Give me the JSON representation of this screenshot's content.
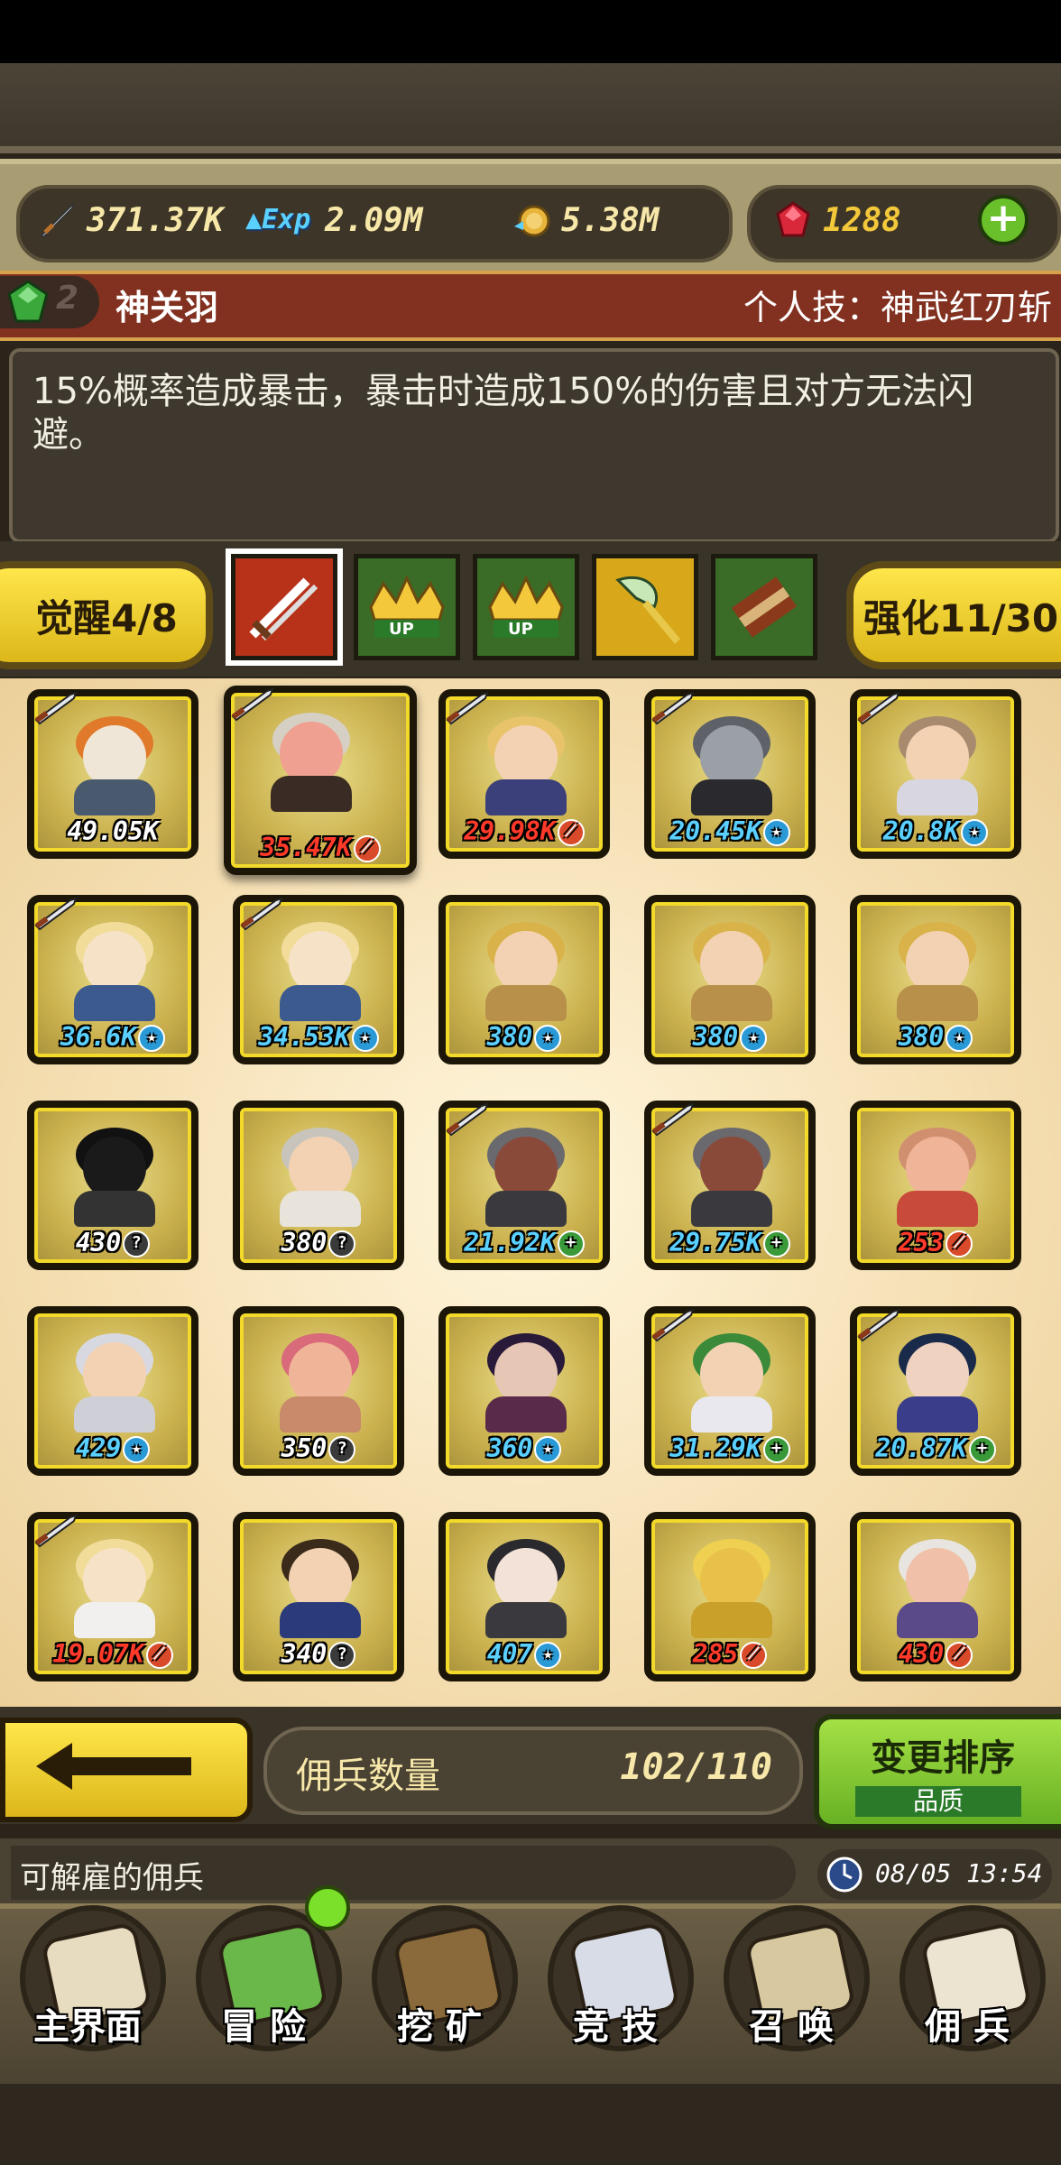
{
  "resources": {
    "attack": "371.37K",
    "exp": "2.09M",
    "gold": "5.38M",
    "gems": "1288"
  },
  "hero": {
    "level_badge": "2",
    "name": "神关羽",
    "skill_title": "个人技：神武红刃斩",
    "skill_desc": "15%概率造成暴击，暴击时造成150%的伤害且对方无法闪避。"
  },
  "tabs": {
    "awaken": "觉醒4/8",
    "enhance": "强化11/30"
  },
  "mercenaries": [
    {
      "value": "49.05K",
      "badge": "",
      "color": "#f0e6d8",
      "body": "#4a5a6e",
      "hair": "#e07a2a"
    },
    {
      "value": "35.47K",
      "badge": "fire",
      "color": "#f0a090",
      "body": "#3a2c24",
      "hair": "#d6d0c4"
    },
    {
      "value": "29.98K",
      "badge": "fire",
      "color": "#f3d2b4",
      "body": "#3b3f7a",
      "hair": "#e8c36a"
    },
    {
      "value": "20.45K",
      "badge": "star",
      "color": "#9aa0a6",
      "body": "#2a2a2e",
      "hair": "#5e6268"
    },
    {
      "value": "20.8K",
      "badge": "star",
      "color": "#f3d2b4",
      "body": "#d8d6e0",
      "hair": "#a88a6e"
    },
    {
      "value": "36.6K",
      "badge": "star",
      "color": "#f6e2c6",
      "body": "#3c5a8e",
      "hair": "#f1dc9a"
    },
    {
      "value": "34.53K",
      "badge": "star",
      "color": "#f6e2c6",
      "body": "#3c5a8e",
      "hair": "#f1dc9a"
    },
    {
      "value": "380",
      "badge": "star",
      "color": "#f3d2b4",
      "body": "#b8904a",
      "hair": "#d9b34a"
    },
    {
      "value": "380",
      "badge": "star",
      "color": "#f3d2b4",
      "body": "#b8904a",
      "hair": "#d9b34a"
    },
    {
      "value": "380",
      "badge": "star",
      "color": "#f3d2b4",
      "body": "#b8904a",
      "hair": "#d9b34a"
    },
    {
      "value": "430",
      "badge": "q",
      "color": "#1a1a1a",
      "body": "#333333",
      "hair": "#111111"
    },
    {
      "value": "380",
      "badge": "q",
      "color": "#f3d2b4",
      "body": "#e8e4dc",
      "hair": "#c8c4bc"
    },
    {
      "value": "21.92K",
      "badge": "plus",
      "color": "#8a4a3a",
      "body": "#3a3a3e",
      "hair": "#6a6a6e"
    },
    {
      "value": "29.75K",
      "badge": "plus",
      "color": "#8a4a3a",
      "body": "#3a3a3e",
      "hair": "#6a6a6e"
    },
    {
      "value": "253",
      "badge": "fire",
      "color": "#f0b498",
      "body": "#c84a3a",
      "hair": "#d09070"
    },
    {
      "value": "429",
      "badge": "star",
      "color": "#f3d2b4",
      "body": "#cfcfd8",
      "hair": "#d8d8e0"
    },
    {
      "value": "350",
      "badge": "q",
      "color": "#f0b498",
      "body": "#c88a6a",
      "hair": "#d86a7a"
    },
    {
      "value": "360",
      "badge": "star",
      "color": "#e6c6b4",
      "body": "#5a2a4a",
      "hair": "#2a1a3a"
    },
    {
      "value": "31.29K",
      "badge": "plus",
      "color": "#f3d2b4",
      "body": "#e8e8ee",
      "hair": "#3a8a3a"
    },
    {
      "value": "20.87K",
      "badge": "plus",
      "color": "#f0d2c0",
      "body": "#3a3e8a",
      "hair": "#1a2a4a"
    },
    {
      "value": "19.07K",
      "badge": "fire",
      "color": "#f6e2c6",
      "body": "#f2f0ee",
      "hair": "#f1dc9a"
    },
    {
      "value": "340",
      "badge": "q",
      "color": "#f3d2b4",
      "body": "#2a3a7a",
      "hair": "#3a2a1a"
    },
    {
      "value": "407",
      "badge": "star",
      "color": "#f3e2d8",
      "body": "#3a3a3e",
      "hair": "#2a2a2e"
    },
    {
      "value": "285",
      "badge": "fire",
      "color": "#e8c04a",
      "body": "#c8a02a",
      "hair": "#f0d050"
    },
    {
      "value": "430",
      "badge": "fire",
      "color": "#f0c0a8",
      "body": "#5a4a8a",
      "hair": "#e8e4e0"
    }
  ],
  "footer": {
    "count_label": "佣兵数量",
    "count_value": "102/110",
    "sort_label": "变更排序",
    "sort_value": "品质",
    "notice": "可解雇的佣兵",
    "time": "08/05 13:54"
  },
  "nav": [
    "主界面",
    "冒 险",
    "挖 矿",
    "竞 技",
    "召 唤",
    "佣 兵"
  ],
  "colors": {
    "fire": "#d94a2a",
    "star": "#2a9ad6",
    "plus": "#3a9a3a",
    "q": "#3a3a3a",
    "value_red": "#ff3a2a",
    "value_blue": "#5ad0ff"
  }
}
